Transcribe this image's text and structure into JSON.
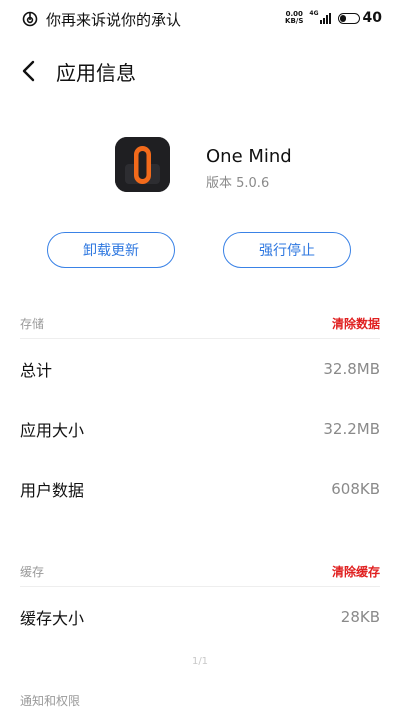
{
  "status_bar": {
    "notification_text": "你再来诉说你的承认",
    "speed_value": "0.00",
    "speed_unit": "KB/S",
    "network": "4G",
    "battery": "40"
  },
  "header": {
    "title": "应用信息"
  },
  "app": {
    "name": "One Mind",
    "version": "版本 5.0.6",
    "icon": "one-mind-app-icon"
  },
  "actions": {
    "uninstall_updates": "卸载更新",
    "force_stop": "强行停止"
  },
  "storage": {
    "label": "存储",
    "action": "清除数据",
    "rows": [
      {
        "label": "总计",
        "value": "32.8MB"
      },
      {
        "label": "应用大小",
        "value": "32.2MB"
      },
      {
        "label": "用户数据",
        "value": "608KB"
      }
    ]
  },
  "cache": {
    "label": "缓存",
    "action": "清除缓存",
    "rows": [
      {
        "label": "缓存大小",
        "value": "28KB"
      }
    ]
  },
  "page_indicator": "1/1",
  "permissions": {
    "label": "通知和权限"
  },
  "colors": {
    "accent_blue": "#3a82e6",
    "danger_red": "#e02020",
    "icon_orange": "#f26a1b"
  }
}
